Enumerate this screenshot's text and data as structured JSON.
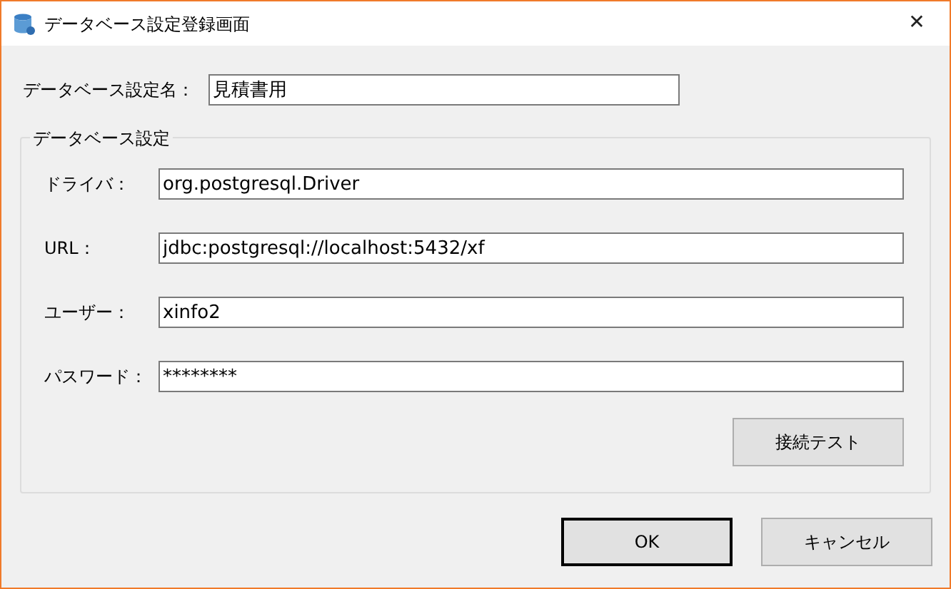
{
  "window": {
    "title": "データベース設定登録画面",
    "close": "✕"
  },
  "name_field": {
    "label": "データベース設定名：",
    "value": "見積書用"
  },
  "group": {
    "title": "データベース設定",
    "fields": [
      {
        "label": "ドライバ：",
        "value": "org.postgresql.Driver"
      },
      {
        "label": "URL：",
        "value": "jdbc:postgresql://localhost:5432/xf"
      },
      {
        "label": "ユーザー：",
        "value": "xinfo2"
      },
      {
        "label": "パスワード：",
        "value": "********"
      }
    ],
    "test_button": "接続テスト"
  },
  "buttons": [
    {
      "label": "OK",
      "default": true
    },
    {
      "label": "キャンセル",
      "default": false
    }
  ]
}
